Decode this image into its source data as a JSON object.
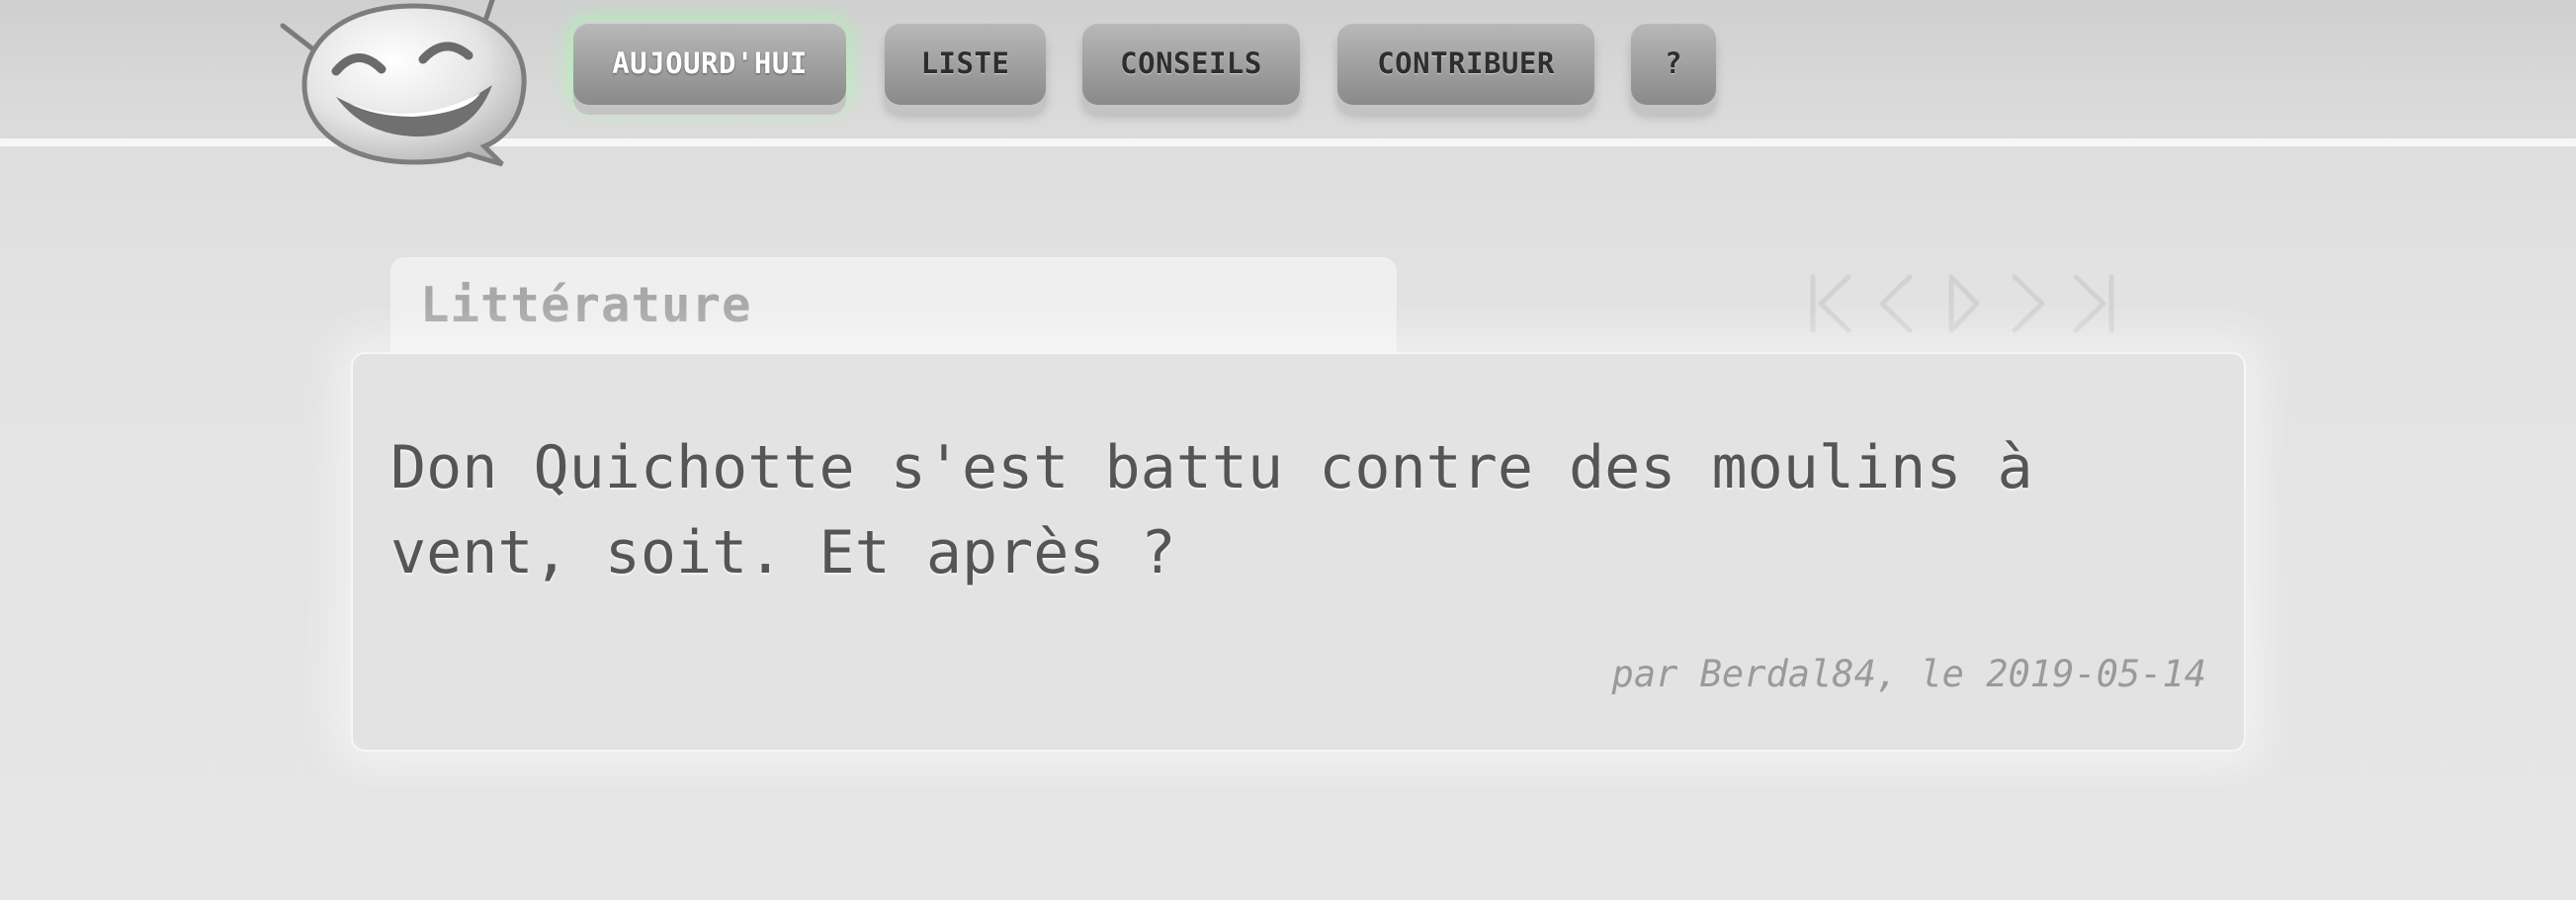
{
  "nav": {
    "items": [
      {
        "label": "AUJOURD'HUI",
        "active": true
      },
      {
        "label": "LISTE",
        "active": false
      },
      {
        "label": "CONSEILS",
        "active": false
      },
      {
        "label": "CONTRIBUER",
        "active": false
      },
      {
        "label": "?",
        "active": false
      }
    ]
  },
  "logo": {
    "icon": "laughing-face-speech-bubble-icon"
  },
  "category": {
    "label": "Littérature"
  },
  "pager": {
    "icons": [
      "first-page-icon",
      "previous-icon",
      "random-play-icon",
      "next-icon",
      "last-page-icon"
    ]
  },
  "quote": {
    "text": "Don Quichotte s'est battu contre des moulins à vent, soit. Et après ?",
    "meta": "par Berdal84, le 2019-05-14"
  },
  "colors": {
    "active_glow": "#a0ffaa",
    "button_gray": "#9f9f9f",
    "text_dark": "#555555",
    "text_muted": "#9a9a9a"
  }
}
